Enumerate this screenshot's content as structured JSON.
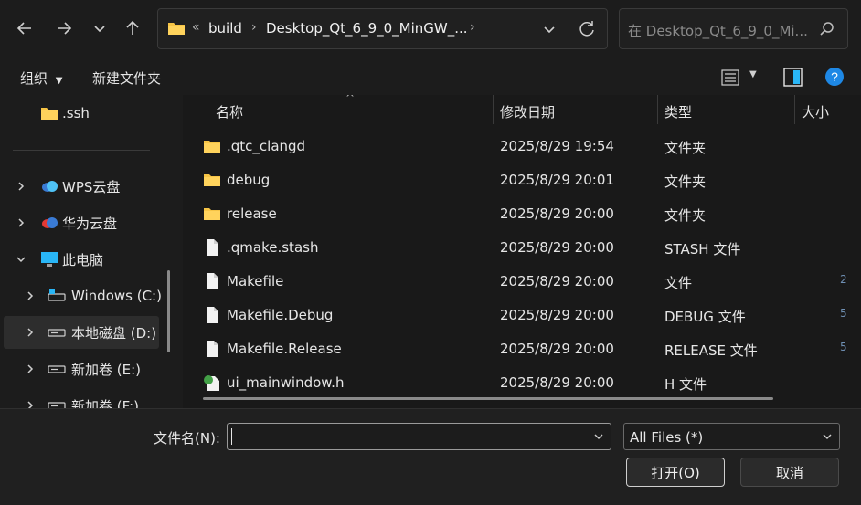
{
  "nav": {
    "back_icon": "arrow-left-icon",
    "forward_icon": "arrow-right-icon",
    "recent_icon": "chevron-down-icon",
    "up_icon": "arrow-up-icon"
  },
  "address": {
    "overflow": "«",
    "crumbs": [
      "build",
      "Desktop_Qt_6_9_0_MinGW_..."
    ],
    "separator": "›"
  },
  "search": {
    "placeholder": "在 Desktop_Qt_6_9_0_Mi..."
  },
  "toolbar": {
    "organize": "组织",
    "new_folder": "新建文件夹"
  },
  "sidebar": {
    "items": [
      {
        "label": ".ssh"
      },
      {
        "label": "WPS云盘"
      },
      {
        "label": "华为云盘"
      },
      {
        "label": "此电脑"
      },
      {
        "label": "Windows (C:)"
      },
      {
        "label": "本地磁盘 (D:)"
      },
      {
        "label": "新加卷 (E:)"
      },
      {
        "label": "新加卷 (F:)"
      }
    ]
  },
  "columns": {
    "name": "名称",
    "date": "修改日期",
    "type": "类型",
    "size": "大小"
  },
  "files": [
    {
      "name": ".qtc_clangd",
      "date": "2025/8/29 19:54",
      "type": "文件夹",
      "icon": "folder-icon"
    },
    {
      "name": "debug",
      "date": "2025/8/29 20:01",
      "type": "文件夹",
      "icon": "folder-icon"
    },
    {
      "name": "release",
      "date": "2025/8/29 20:00",
      "type": "文件夹",
      "icon": "folder-icon"
    },
    {
      "name": ".qmake.stash",
      "date": "2025/8/29 20:00",
      "type": "STASH 文件",
      "icon": "file-icon"
    },
    {
      "name": "Makefile",
      "date": "2025/8/29 20:00",
      "type": "文件",
      "icon": "file-icon",
      "size": "2"
    },
    {
      "name": "Makefile.Debug",
      "date": "2025/8/29 20:00",
      "type": "DEBUG 文件",
      "icon": "file-icon",
      "size": "5"
    },
    {
      "name": "Makefile.Release",
      "date": "2025/8/29 20:00",
      "type": "RELEASE 文件",
      "icon": "file-icon",
      "size": "5"
    },
    {
      "name": "ui_mainwindow.h",
      "date": "2025/8/29 20:00",
      "type": "H 文件",
      "icon": "header-file-icon"
    }
  ],
  "bottom": {
    "filename_label": "文件名(N):",
    "filename_value": "",
    "filter_value": "All Files (*)",
    "open_label": "打开(O)",
    "cancel_label": "取消"
  },
  "colors": {
    "folder": "#f6c445",
    "help": "#1e88e5",
    "wps_cloud": "#3a7bd5",
    "huawei_cloud": "#e53935",
    "pc": "#29b6f6"
  }
}
